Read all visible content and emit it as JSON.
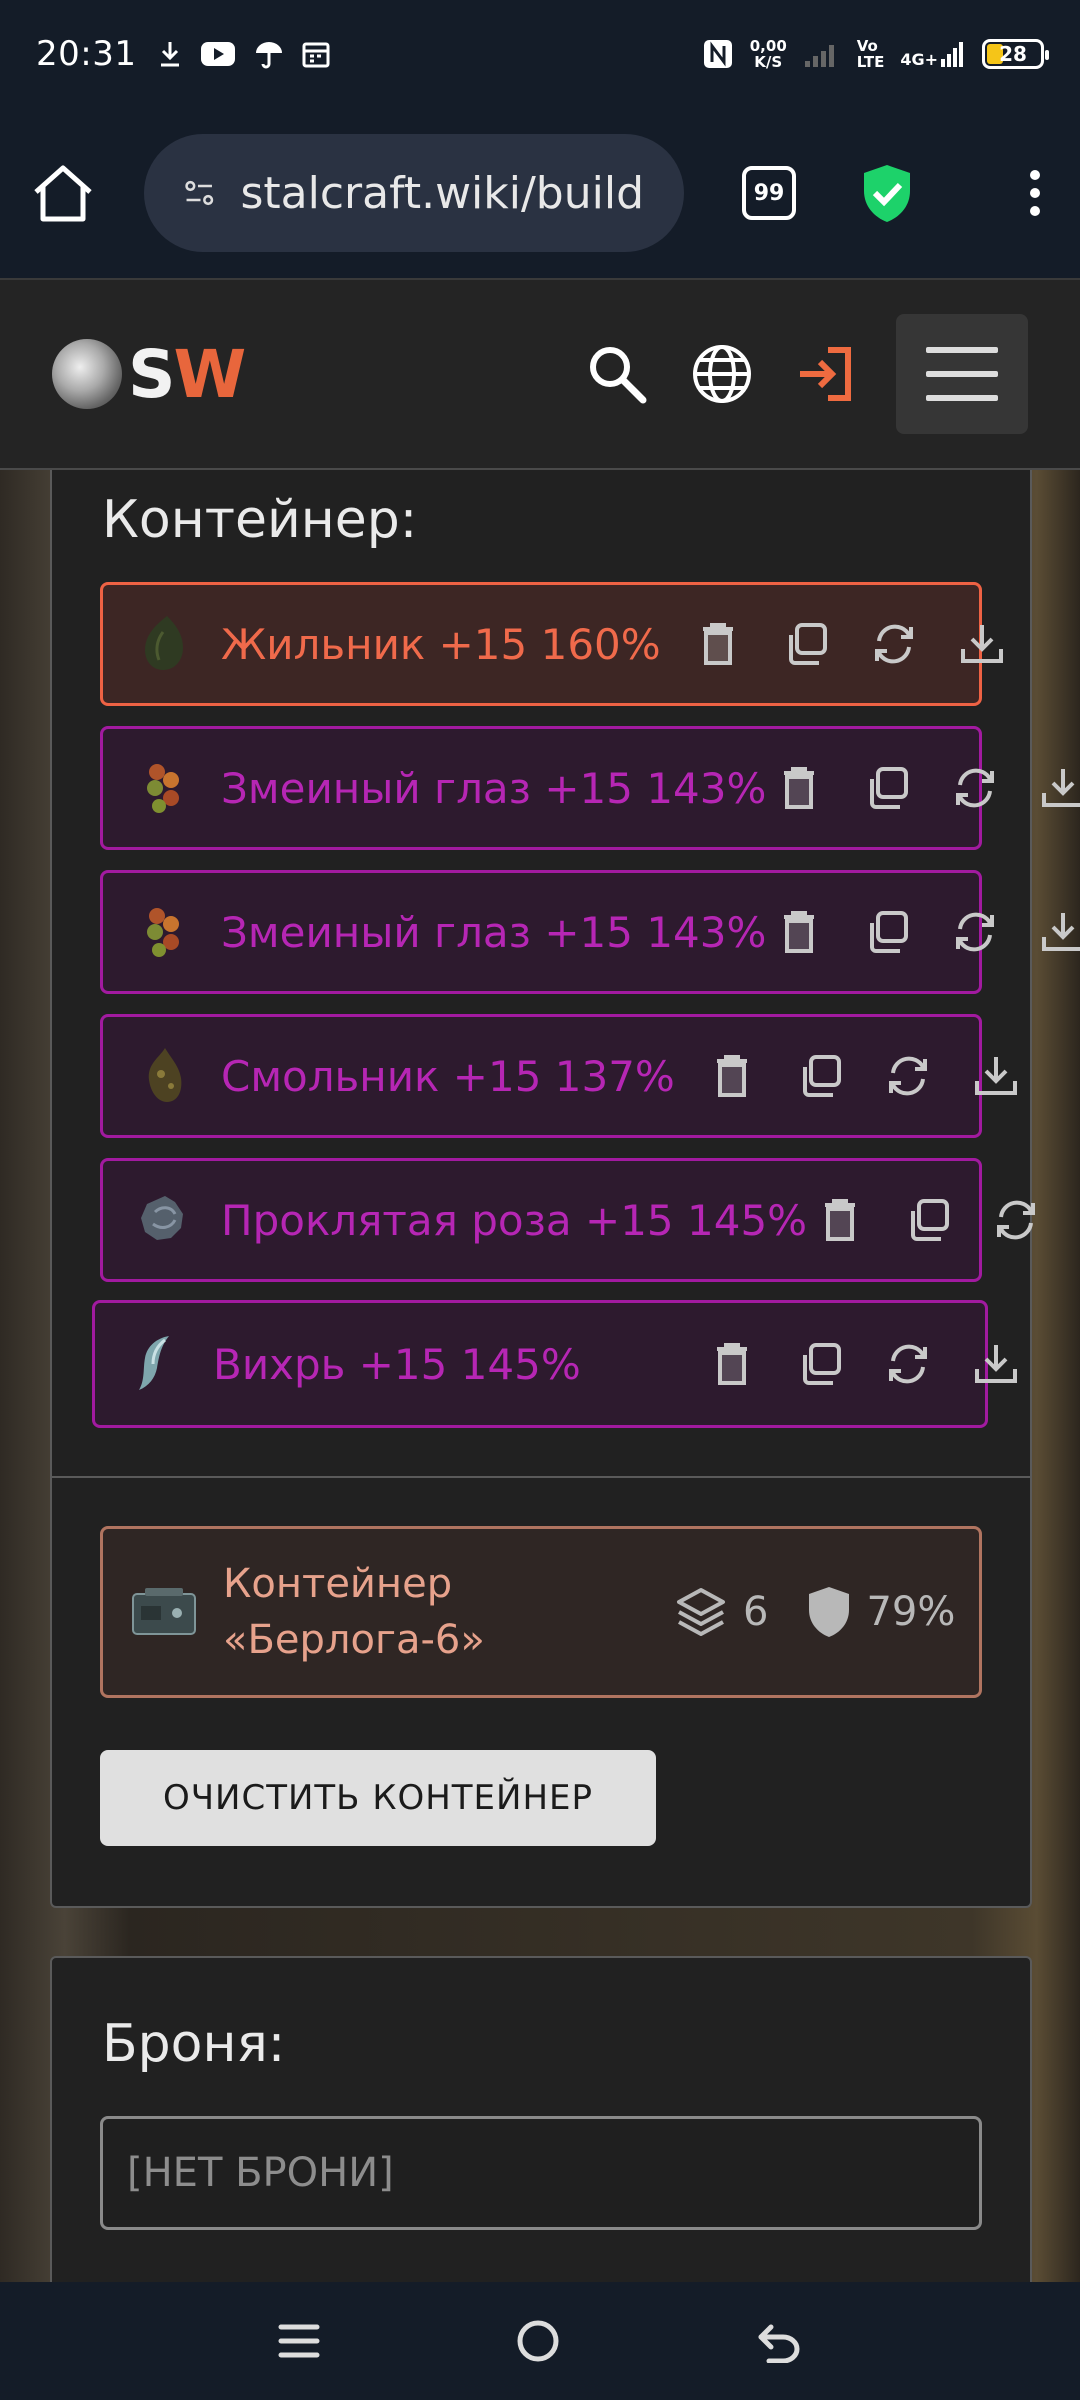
{
  "status": {
    "time": "20:31",
    "net_speed_value": "0,00",
    "net_speed_unit": "K/S",
    "volte_top": "Vo",
    "volte_bottom": "LTE",
    "network": "4G+",
    "battery": "28"
  },
  "browser": {
    "url": "stalcraft.wiki/build",
    "tab_count": "99"
  },
  "site": {
    "logo_s": "S",
    "logo_w": "W"
  },
  "container_section": {
    "title": "Контейнер:",
    "items": [
      {
        "label": "Жильник +15 160%",
        "rarity": "legendary",
        "color": "#f06a4b"
      },
      {
        "label": "Змеиный глаз +15 143%",
        "rarity": "exceptional",
        "color": "#b626b4"
      },
      {
        "label": "Змеиный глаз +15 143%",
        "rarity": "exceptional",
        "color": "#b626b4"
      },
      {
        "label": "Смольник +15 137%",
        "rarity": "exceptional",
        "color": "#b626b4"
      },
      {
        "label": "Проклятая роза +15 145%",
        "rarity": "exceptional",
        "color": "#b626b4"
      },
      {
        "label": "Вихрь +15 145%",
        "rarity": "exceptional",
        "color": "#b626b4"
      }
    ],
    "container_card": {
      "name_line1": "Контейнер",
      "name_line2": "«Берлога-6»",
      "slots": "6",
      "protection": "79%"
    },
    "clear_button": "ОЧИСТИТЬ КОНТЕЙНЕР"
  },
  "armor_section": {
    "title": "Броня:",
    "value": "[НЕТ БРОНИ]"
  }
}
